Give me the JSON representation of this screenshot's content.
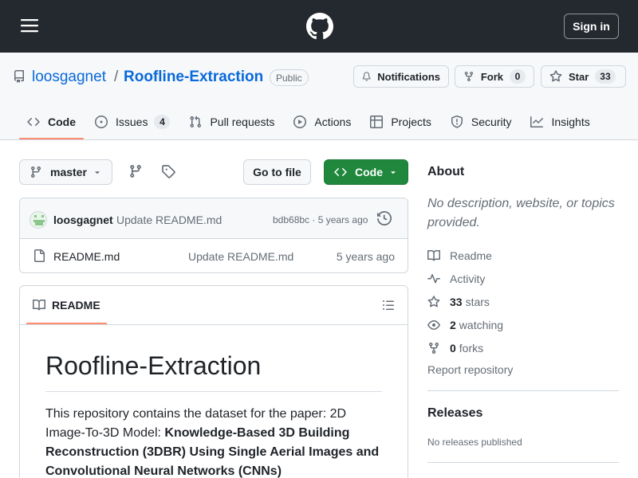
{
  "header": {
    "signin_label": "Sign in"
  },
  "repo": {
    "owner": "loosgagnet",
    "separator": "/",
    "name": "Roofline-Extraction",
    "visibility": "Public",
    "notifications_label": "Notifications",
    "fork_label": "Fork",
    "fork_count": "0",
    "star_label": "Star",
    "star_count": "33"
  },
  "tabs": [
    {
      "label": "Code",
      "icon": "code-icon",
      "active": true
    },
    {
      "label": "Issues",
      "icon": "issue-icon",
      "count": "4"
    },
    {
      "label": "Pull requests",
      "icon": "pull-request-icon"
    },
    {
      "label": "Actions",
      "icon": "play-icon"
    },
    {
      "label": "Projects",
      "icon": "table-icon"
    },
    {
      "label": "Security",
      "icon": "shield-icon"
    },
    {
      "label": "Insights",
      "icon": "graph-icon"
    }
  ],
  "toolbar": {
    "branch": "master",
    "goto_file": "Go to file",
    "code_label": "Code"
  },
  "latest_commit": {
    "author": "loosgagnet",
    "message": "Update README.md",
    "meta": "bdb68bc · 5 years ago"
  },
  "files": [
    {
      "name": "README.md",
      "message": "Update README.md",
      "age": "5 years ago"
    }
  ],
  "readme": {
    "tab_label": "README",
    "title": "Roofline-Extraction",
    "text_plain": "This repository contains the dataset for the paper: 2D Image-To-3D Model: ",
    "text_bold": "Knowledge-Based 3D Building Reconstruction (3DBR) Using Single Aerial Images and Convolutional Neural Networks (CNNs)"
  },
  "about": {
    "heading": "About",
    "description": "No description, website, or topics provided.",
    "readme_link": "Readme",
    "activity_link": "Activity",
    "stars_count": "33",
    "stars_label": "stars",
    "watching_count": "2",
    "watching_label": "watching",
    "forks_count": "0",
    "forks_label": "forks",
    "report": "Report repository"
  },
  "releases": {
    "heading": "Releases",
    "empty": "No releases published"
  },
  "colors": {
    "header_bg": "#24292f",
    "link": "#0969da",
    "primary_button": "#1f883d",
    "active_tab_underline": "#fd8c73"
  }
}
